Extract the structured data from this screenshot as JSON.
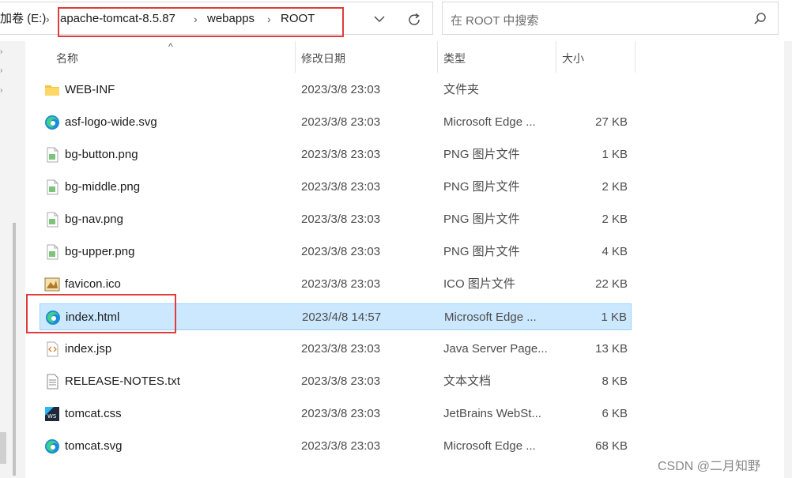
{
  "address_bar": {
    "crumbs": [
      "加卷 (E:)",
      "apache-tomcat-8.5.87",
      "webapps",
      "ROOT"
    ]
  },
  "search": {
    "placeholder": "在 ROOT 中搜索"
  },
  "columns": {
    "name": "名称",
    "date": "修改日期",
    "type": "类型",
    "size": "大小"
  },
  "files": [
    {
      "name": "WEB-INF",
      "date": "2023/3/8 23:03",
      "type": "文件夹",
      "size": "",
      "icon": "folder-icon"
    },
    {
      "name": "asf-logo-wide.svg",
      "date": "2023/3/8 23:03",
      "type": "Microsoft Edge ...",
      "size": "27 KB",
      "icon": "edge-icon"
    },
    {
      "name": "bg-button.png",
      "date": "2023/3/8 23:03",
      "type": "PNG 图片文件",
      "size": "1 KB",
      "icon": "png-icon"
    },
    {
      "name": "bg-middle.png",
      "date": "2023/3/8 23:03",
      "type": "PNG 图片文件",
      "size": "2 KB",
      "icon": "png-icon"
    },
    {
      "name": "bg-nav.png",
      "date": "2023/3/8 23:03",
      "type": "PNG 图片文件",
      "size": "2 KB",
      "icon": "png-icon"
    },
    {
      "name": "bg-upper.png",
      "date": "2023/3/8 23:03",
      "type": "PNG 图片文件",
      "size": "4 KB",
      "icon": "png-icon"
    },
    {
      "name": "favicon.ico",
      "date": "2023/3/8 23:03",
      "type": "ICO 图片文件",
      "size": "22 KB",
      "icon": "ico-icon"
    },
    {
      "name": "index.html",
      "date": "2023/4/8 14:57",
      "type": "Microsoft Edge ...",
      "size": "1 KB",
      "icon": "edge-icon",
      "selected": true
    },
    {
      "name": "index.jsp",
      "date": "2023/3/8 23:03",
      "type": "Java Server Page...",
      "size": "13 KB",
      "icon": "jsp-icon"
    },
    {
      "name": "RELEASE-NOTES.txt",
      "date": "2023/3/8 23:03",
      "type": "文本文档",
      "size": "8 KB",
      "icon": "txt-icon"
    },
    {
      "name": "tomcat.css",
      "date": "2023/3/8 23:03",
      "type": "JetBrains WebSt...",
      "size": "6 KB",
      "icon": "webstorm-icon"
    },
    {
      "name": "tomcat.svg",
      "date": "2023/3/8 23:03",
      "type": "Microsoft Edge ...",
      "size": "68 KB",
      "icon": "edge-icon"
    }
  ],
  "colors": {
    "selection": "#cce8ff",
    "selection_border": "#99d1ff",
    "annotation": "#e03c3c"
  },
  "watermark": "CSDN @二月知野"
}
